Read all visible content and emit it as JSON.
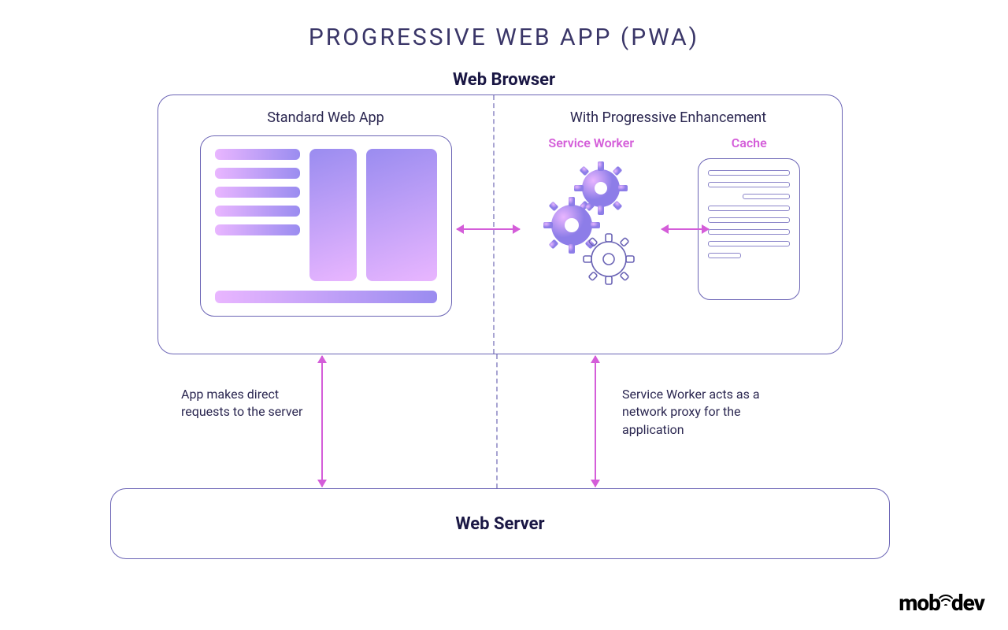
{
  "title": "PROGRESSIVE WEB APP (PWA)",
  "browser_label": "Web Browser",
  "left": {
    "heading": "Standard Web App",
    "note": "App makes direct requests to the server"
  },
  "right": {
    "heading": "With Progressive Enhancement",
    "service_worker_label": "Service Worker",
    "cache_label": "Cache",
    "note": "Service Worker acts as a network proxy for the application"
  },
  "server_label": "Web Server",
  "logo_text": "mobidev",
  "colors": {
    "border": "#6b64b5",
    "accent": "#d45dd9",
    "text": "#1a1744"
  }
}
